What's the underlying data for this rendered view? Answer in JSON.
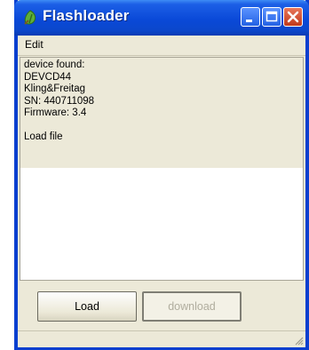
{
  "window": {
    "title": "Flashloader"
  },
  "menu": {
    "items": [
      "Edit"
    ]
  },
  "output": {
    "lines": [
      "device found:",
      "DEVCD44",
      "Kling&Freitag",
      "SN: 440711098",
      "Firmware: 3.4",
      "",
      "Load file"
    ]
  },
  "buttons": {
    "load_label": "Load",
    "download_label": "download"
  },
  "colors": {
    "titlebar": "#0a49d8",
    "window_face": "#ece9d8",
    "close_button": "#c1391b",
    "disabled_text": "#b0ad9e"
  },
  "icons": {
    "app": "green-leaf-icon",
    "minimize": "minimize-icon",
    "maximize": "maximize-icon",
    "close": "close-icon",
    "resize": "resize-grip-icon"
  }
}
